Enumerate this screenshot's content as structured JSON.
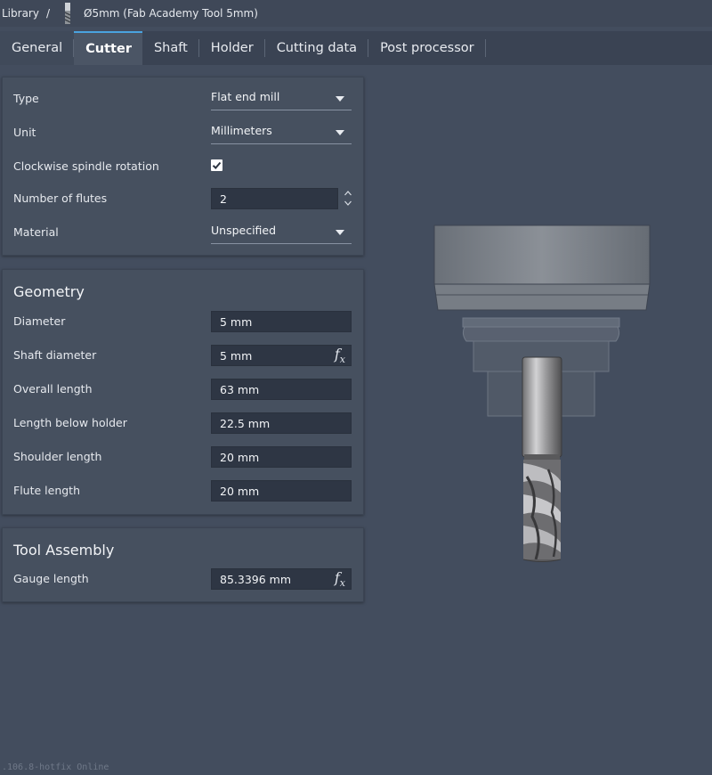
{
  "breadcrumb": {
    "library": "Library",
    "separator": "/",
    "tool_name": "Ø5mm (Fab Academy Tool 5mm)"
  },
  "tabs": [
    {
      "label": "General",
      "active": false
    },
    {
      "label": "Cutter",
      "active": true
    },
    {
      "label": "Shaft",
      "active": false
    },
    {
      "label": "Holder",
      "active": false
    },
    {
      "label": "Cutting data",
      "active": false
    },
    {
      "label": "Post processor",
      "active": false
    }
  ],
  "cutter": {
    "type": {
      "label": "Type",
      "value": "Flat end mill"
    },
    "unit": {
      "label": "Unit",
      "value": "Millimeters"
    },
    "clockwise": {
      "label": "Clockwise spindle rotation",
      "checked": true
    },
    "flutes": {
      "label": "Number of flutes",
      "value": "2"
    },
    "material": {
      "label": "Material",
      "value": "Unspecified"
    }
  },
  "geometry": {
    "title": "Geometry",
    "diameter": {
      "label": "Diameter",
      "value": "5 mm"
    },
    "shaft_diameter": {
      "label": "Shaft diameter",
      "value": "5 mm"
    },
    "overall_length": {
      "label": "Overall length",
      "value": "63 mm"
    },
    "length_below_holder": {
      "label": "Length below holder",
      "value": "22.5 mm"
    },
    "shoulder_length": {
      "label": "Shoulder length",
      "value": "20 mm"
    },
    "flute_length": {
      "label": "Flute length",
      "value": "20 mm"
    }
  },
  "assembly": {
    "title": "Tool Assembly",
    "gauge_length": {
      "label": "Gauge length",
      "value": "85.3396 mm"
    }
  },
  "fx_label": "f",
  "fx_sub": "x",
  "footer": {
    "version": ".106.8-hotfix Online"
  },
  "colors": {
    "background": "#434d5e",
    "panel": "#46505f",
    "input": "#2e3644",
    "accent": "#4aa3df"
  }
}
